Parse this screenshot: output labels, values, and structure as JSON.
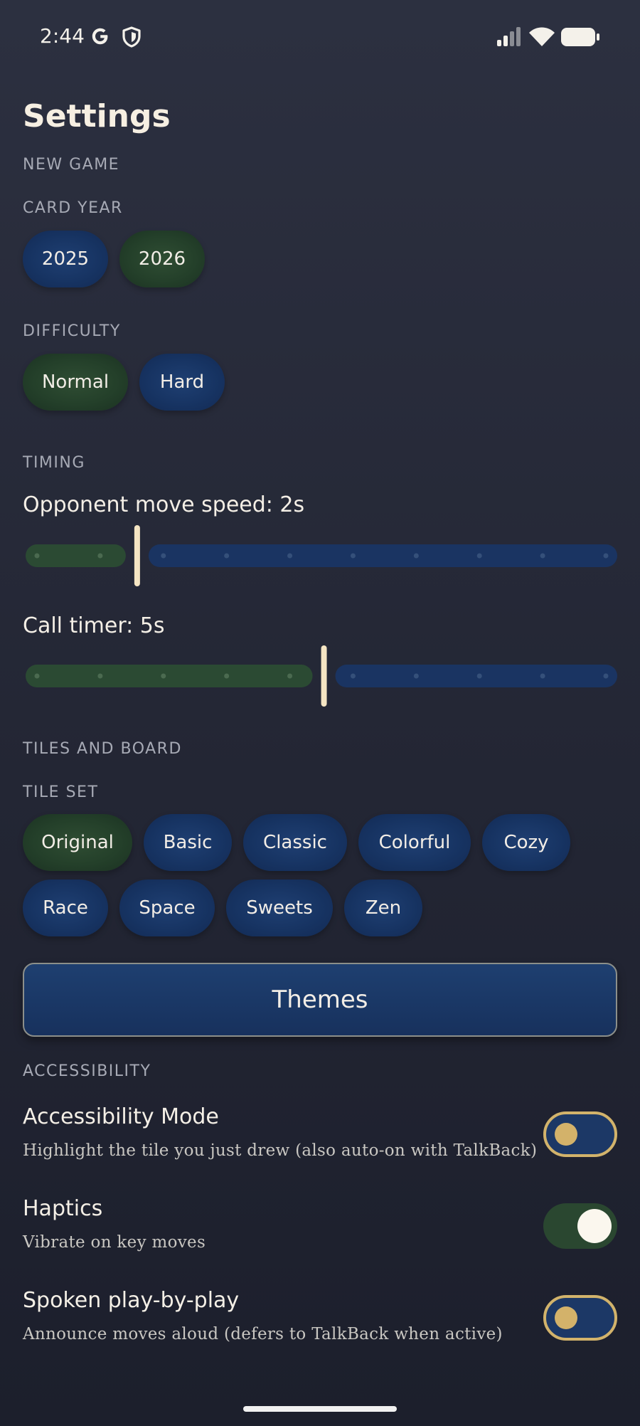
{
  "status_bar": {
    "time": "2:44",
    "icons": [
      "google-g-icon",
      "shield-icon",
      "signal-icon",
      "wifi-icon",
      "battery-icon"
    ]
  },
  "page": {
    "title": "Settings"
  },
  "new_game": {
    "section_label": "NEW GAME",
    "card_year": {
      "label": "CARD YEAR",
      "options": [
        "2025",
        "2026"
      ],
      "selected": "2026"
    },
    "difficulty": {
      "label": "DIFFICULTY",
      "options": [
        "Normal",
        "Hard"
      ],
      "selected": "Normal"
    }
  },
  "timing": {
    "section_label": "TIMING",
    "opponent_speed": {
      "label": "Opponent move speed: 2s",
      "value": 2,
      "steps": 10,
      "step_index": 1
    },
    "call_timer": {
      "label": "Call timer: 5s",
      "value": 5,
      "steps": 10,
      "step_index": 4
    }
  },
  "tiles_and_board": {
    "section_label": "TILES AND BOARD",
    "tile_set": {
      "label": "TILE SET",
      "options_row1": [
        "Original",
        "Basic",
        "Classic",
        "Colorful",
        "Cozy"
      ],
      "options_row2": [
        "Race",
        "Space",
        "Sweets",
        "Zen"
      ],
      "selected": "Original"
    },
    "themes_button": "Themes"
  },
  "accessibility": {
    "section_label": "ACCESSIBILITY",
    "items": [
      {
        "title": "Accessibility Mode",
        "description": "Highlight the tile you just drew (also auto-on with TalkBack)",
        "enabled": false
      },
      {
        "title": "Haptics",
        "description": "Vibrate on key moves",
        "enabled": true
      },
      {
        "title": "Spoken play-by-play",
        "description": "Announce moves aloud (defers to TalkBack when active)",
        "enabled": false
      }
    ]
  },
  "colors": {
    "accent_gold": "#d2b36b",
    "chip_blue": "#173463",
    "chip_green": "#24402a",
    "slider_blue": "#1a3462",
    "slider_green": "#2b4a33",
    "thumb": "#f5e5c3"
  }
}
